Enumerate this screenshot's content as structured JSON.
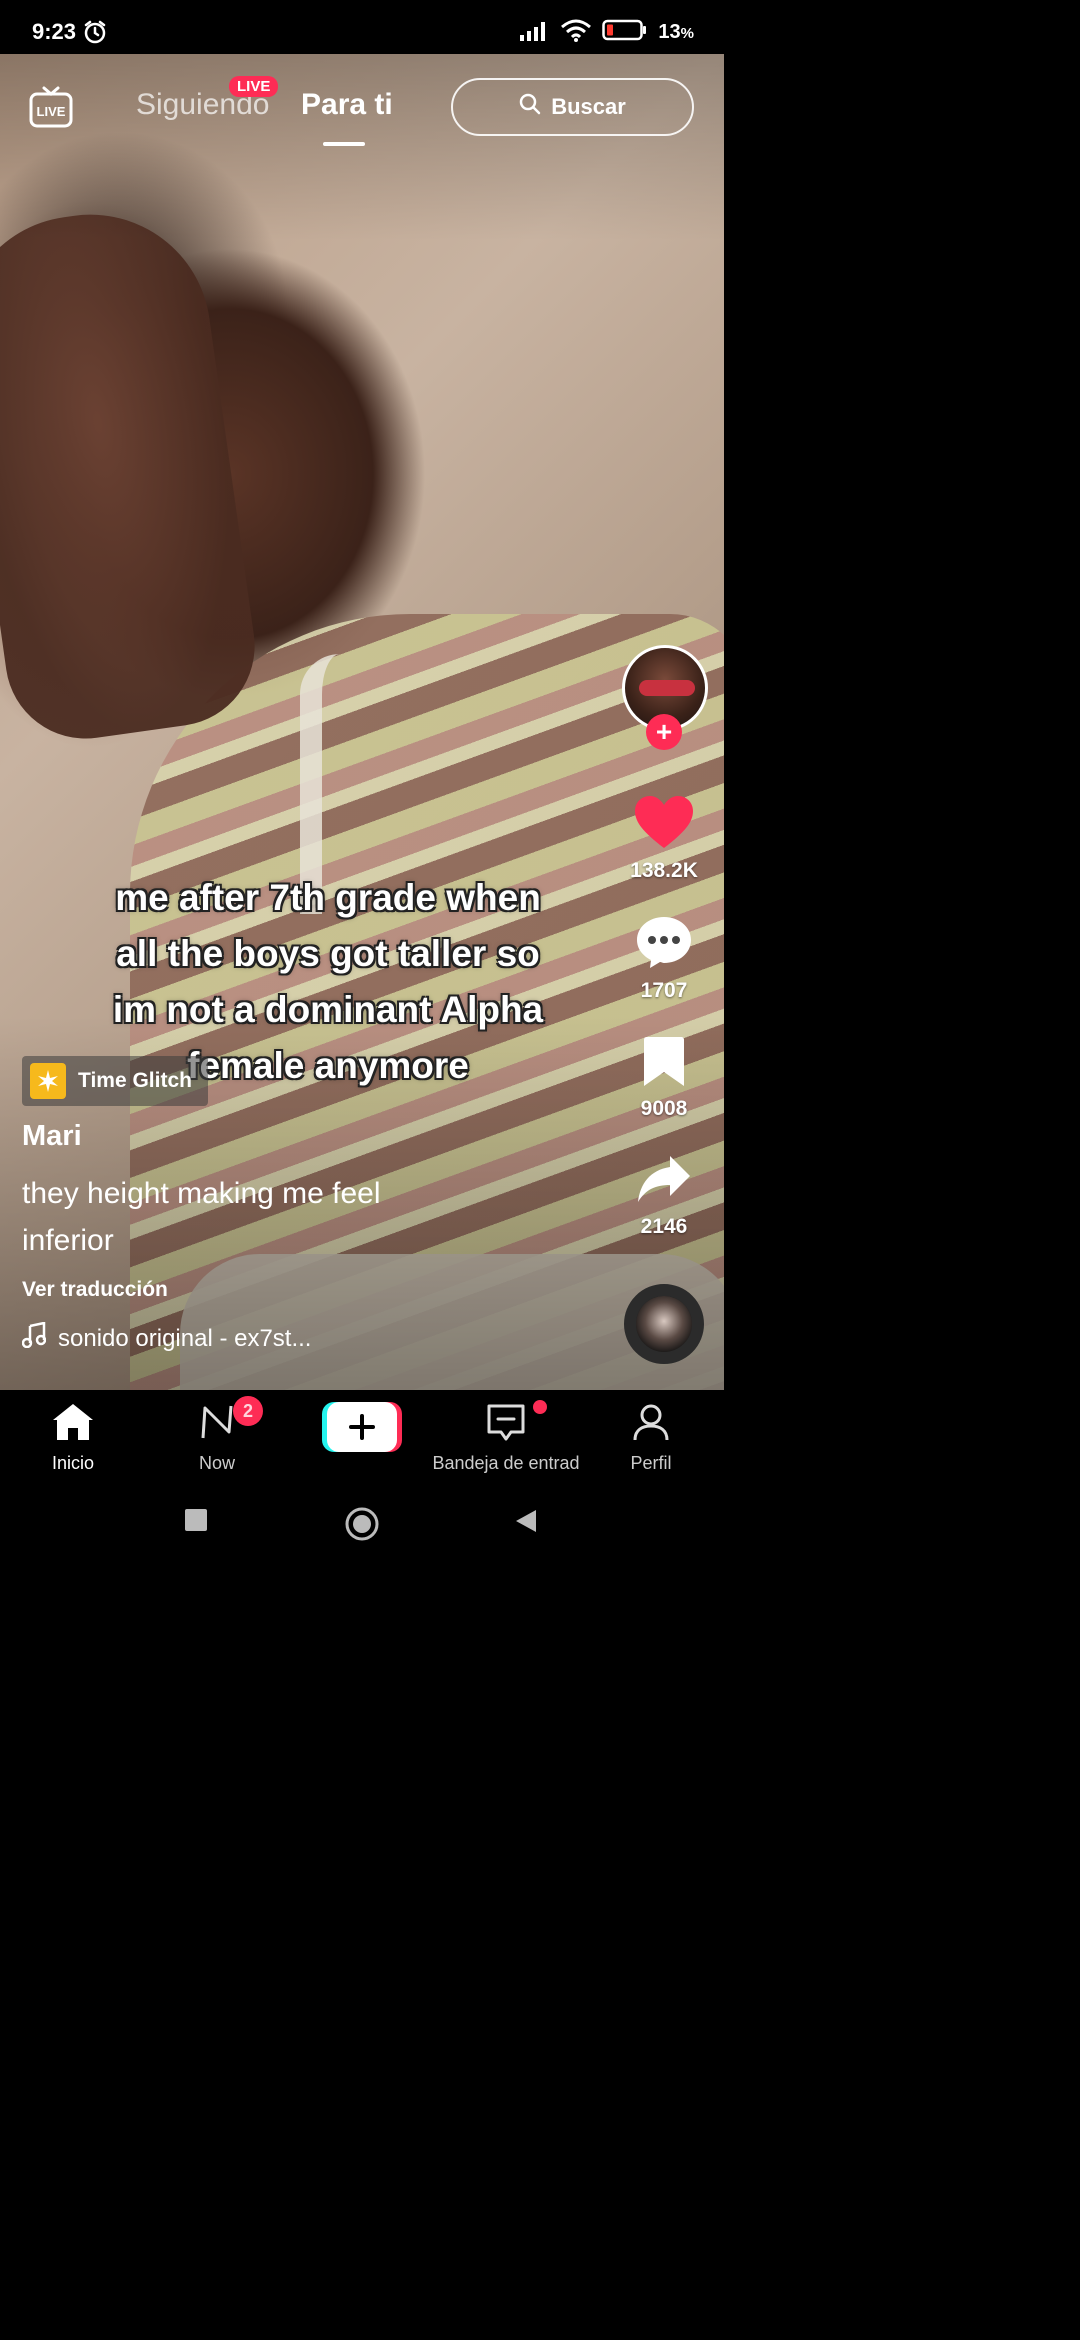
{
  "status_bar": {
    "time": "9:23",
    "battery": "13",
    "battery_unit": "%"
  },
  "top_nav": {
    "following": "Siguiendo",
    "live_badge": "LIVE",
    "for_you": "Para ti",
    "search": "Buscar"
  },
  "video": {
    "caption_lines": [
      "me after 7th grade when",
      "all the boys got taller so",
      "im not a dominant Alpha",
      "female anymore"
    ]
  },
  "right_rail": {
    "likes": "138.2K",
    "comments": "1707",
    "saves": "9008",
    "shares": "2146"
  },
  "post": {
    "effect": "Time Glitch",
    "username": "Mari",
    "description": "they height making me feel inferior",
    "translate": "Ver traducción",
    "sound": "sonido original - ex7st..."
  },
  "bottom_nav": {
    "home": "Inicio",
    "now": "Now",
    "now_badge": "2",
    "inbox": "Bandeja de entrad",
    "profile": "Perfil"
  },
  "colors": {
    "accent": "#fe2c55",
    "cyan": "#25f4ee",
    "effect": "#f6b91c"
  }
}
